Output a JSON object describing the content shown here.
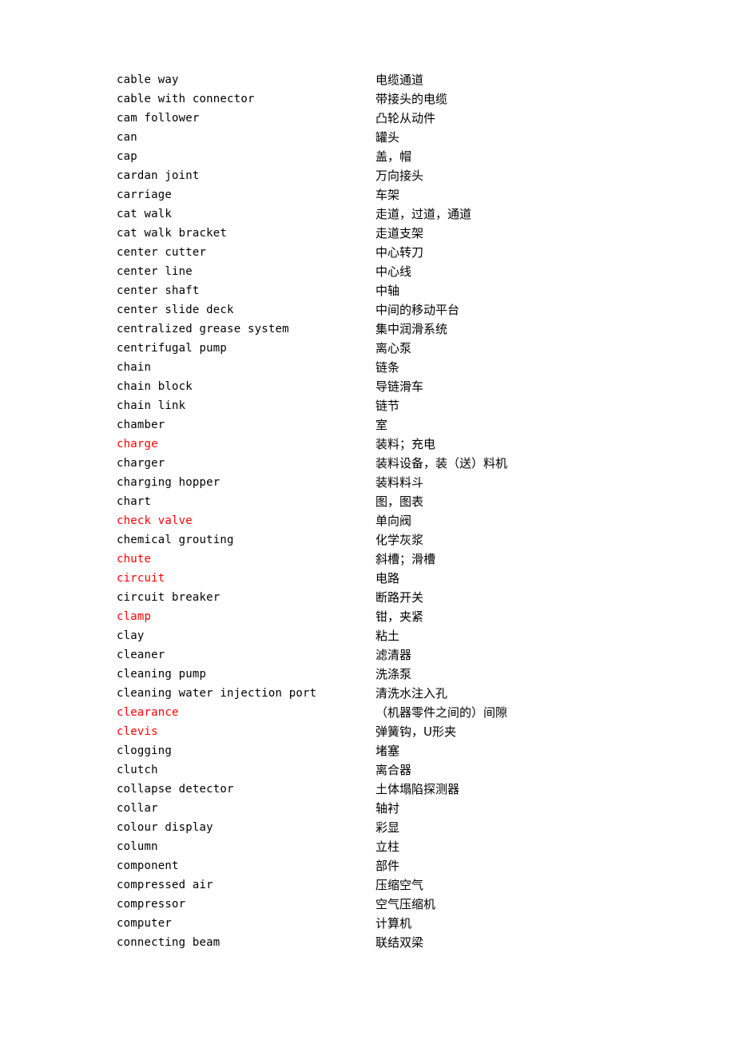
{
  "document": {
    "type": "bilingual-glossary",
    "letter_section": "C",
    "columns": [
      "term",
      "translation"
    ],
    "highlight_color": "#ff0000",
    "text_color": "#000000",
    "background_color": "#ffffff"
  },
  "entries": [
    {
      "term": "cable way",
      "gloss": "电缆通道",
      "highlight": false
    },
    {
      "term": "cable with connector",
      "gloss": "带接头的电缆",
      "highlight": false
    },
    {
      "term": "cam follower",
      "gloss": "凸轮从动件",
      "highlight": false
    },
    {
      "term": "can",
      "gloss": "罐头",
      "highlight": false
    },
    {
      "term": "cap",
      "gloss": "盖，帽",
      "highlight": false
    },
    {
      "term": "cardan joint",
      "gloss": "万向接头",
      "highlight": false
    },
    {
      "term": "carriage",
      "gloss": "车架",
      "highlight": false
    },
    {
      "term": "cat walk",
      "gloss": "走道，过道，通道",
      "highlight": false
    },
    {
      "term": "cat walk bracket",
      "gloss": "走道支架",
      "highlight": false
    },
    {
      "term": "center cutter",
      "gloss": "中心转刀",
      "highlight": false
    },
    {
      "term": "center line",
      "gloss": "中心线",
      "highlight": false
    },
    {
      "term": "center shaft",
      "gloss": "中轴",
      "highlight": false
    },
    {
      "term": "center slide deck",
      "gloss": "中间的移动平台",
      "highlight": false
    },
    {
      "term": "centralized grease system",
      "gloss": "集中润滑系统",
      "highlight": false
    },
    {
      "term": "centrifugal pump",
      "gloss": "离心泵",
      "highlight": false
    },
    {
      "term": "chain",
      "gloss": "链条",
      "highlight": false
    },
    {
      "term": "chain block",
      "gloss": "导链滑车",
      "highlight": false
    },
    {
      "term": "chain link",
      "gloss": "链节",
      "highlight": false
    },
    {
      "term": "chamber",
      "gloss": "室",
      "highlight": false
    },
    {
      "term": "charge",
      "gloss": "装料；充电",
      "highlight": true
    },
    {
      "term": "charger",
      "gloss": "装料设备，装（送）料机",
      "highlight": false
    },
    {
      "term": "charging hopper",
      "gloss": "装料料斗",
      "highlight": false
    },
    {
      "term": "chart",
      "gloss": "图，图表",
      "highlight": false
    },
    {
      "term": "check valve",
      "gloss": "单向阀",
      "highlight": true
    },
    {
      "term": "chemical grouting",
      "gloss": "化学灰浆",
      "highlight": false
    },
    {
      "term": "chute",
      "gloss": "斜槽；滑槽",
      "highlight": true
    },
    {
      "term": "circuit",
      "gloss": "电路",
      "highlight": true
    },
    {
      "term": "circuit breaker",
      "gloss": "断路开关",
      "highlight": false
    },
    {
      "term": "clamp",
      "gloss": "钳，夹紧",
      "highlight": true
    },
    {
      "term": "clay",
      "gloss": "粘土",
      "highlight": false
    },
    {
      "term": "cleaner",
      "gloss": "滤清器",
      "highlight": false
    },
    {
      "term": "cleaning pump",
      "gloss": "洗涤泵",
      "highlight": false
    },
    {
      "term": "cleaning water injection port",
      "gloss": "清洗水注入孔",
      "highlight": false
    },
    {
      "term": "clearance",
      "gloss": "（机器零件之间的）间隙",
      "highlight": true
    },
    {
      "term": "clevis",
      "gloss": "弹簧钩，U形夹",
      "highlight": true
    },
    {
      "term": "clogging",
      "gloss": "堵塞",
      "highlight": false
    },
    {
      "term": "clutch",
      "gloss": "离合器",
      "highlight": false
    },
    {
      "term": "collapse detector",
      "gloss": "土体塌陷探测器",
      "highlight": false
    },
    {
      "term": "collar",
      "gloss": "轴衬",
      "highlight": false
    },
    {
      "term": "colour display",
      "gloss": "彩显",
      "highlight": false
    },
    {
      "term": "column",
      "gloss": "立柱",
      "highlight": false
    },
    {
      "term": "component",
      "gloss": "部件",
      "highlight": false
    },
    {
      "term": "compressed air",
      "gloss": "压缩空气",
      "highlight": false
    },
    {
      "term": "compressor",
      "gloss": "空气压缩机",
      "highlight": false
    },
    {
      "term": "computer",
      "gloss": "计算机",
      "highlight": false
    },
    {
      "term": "connecting beam",
      "gloss": "联结双梁",
      "highlight": false
    }
  ]
}
